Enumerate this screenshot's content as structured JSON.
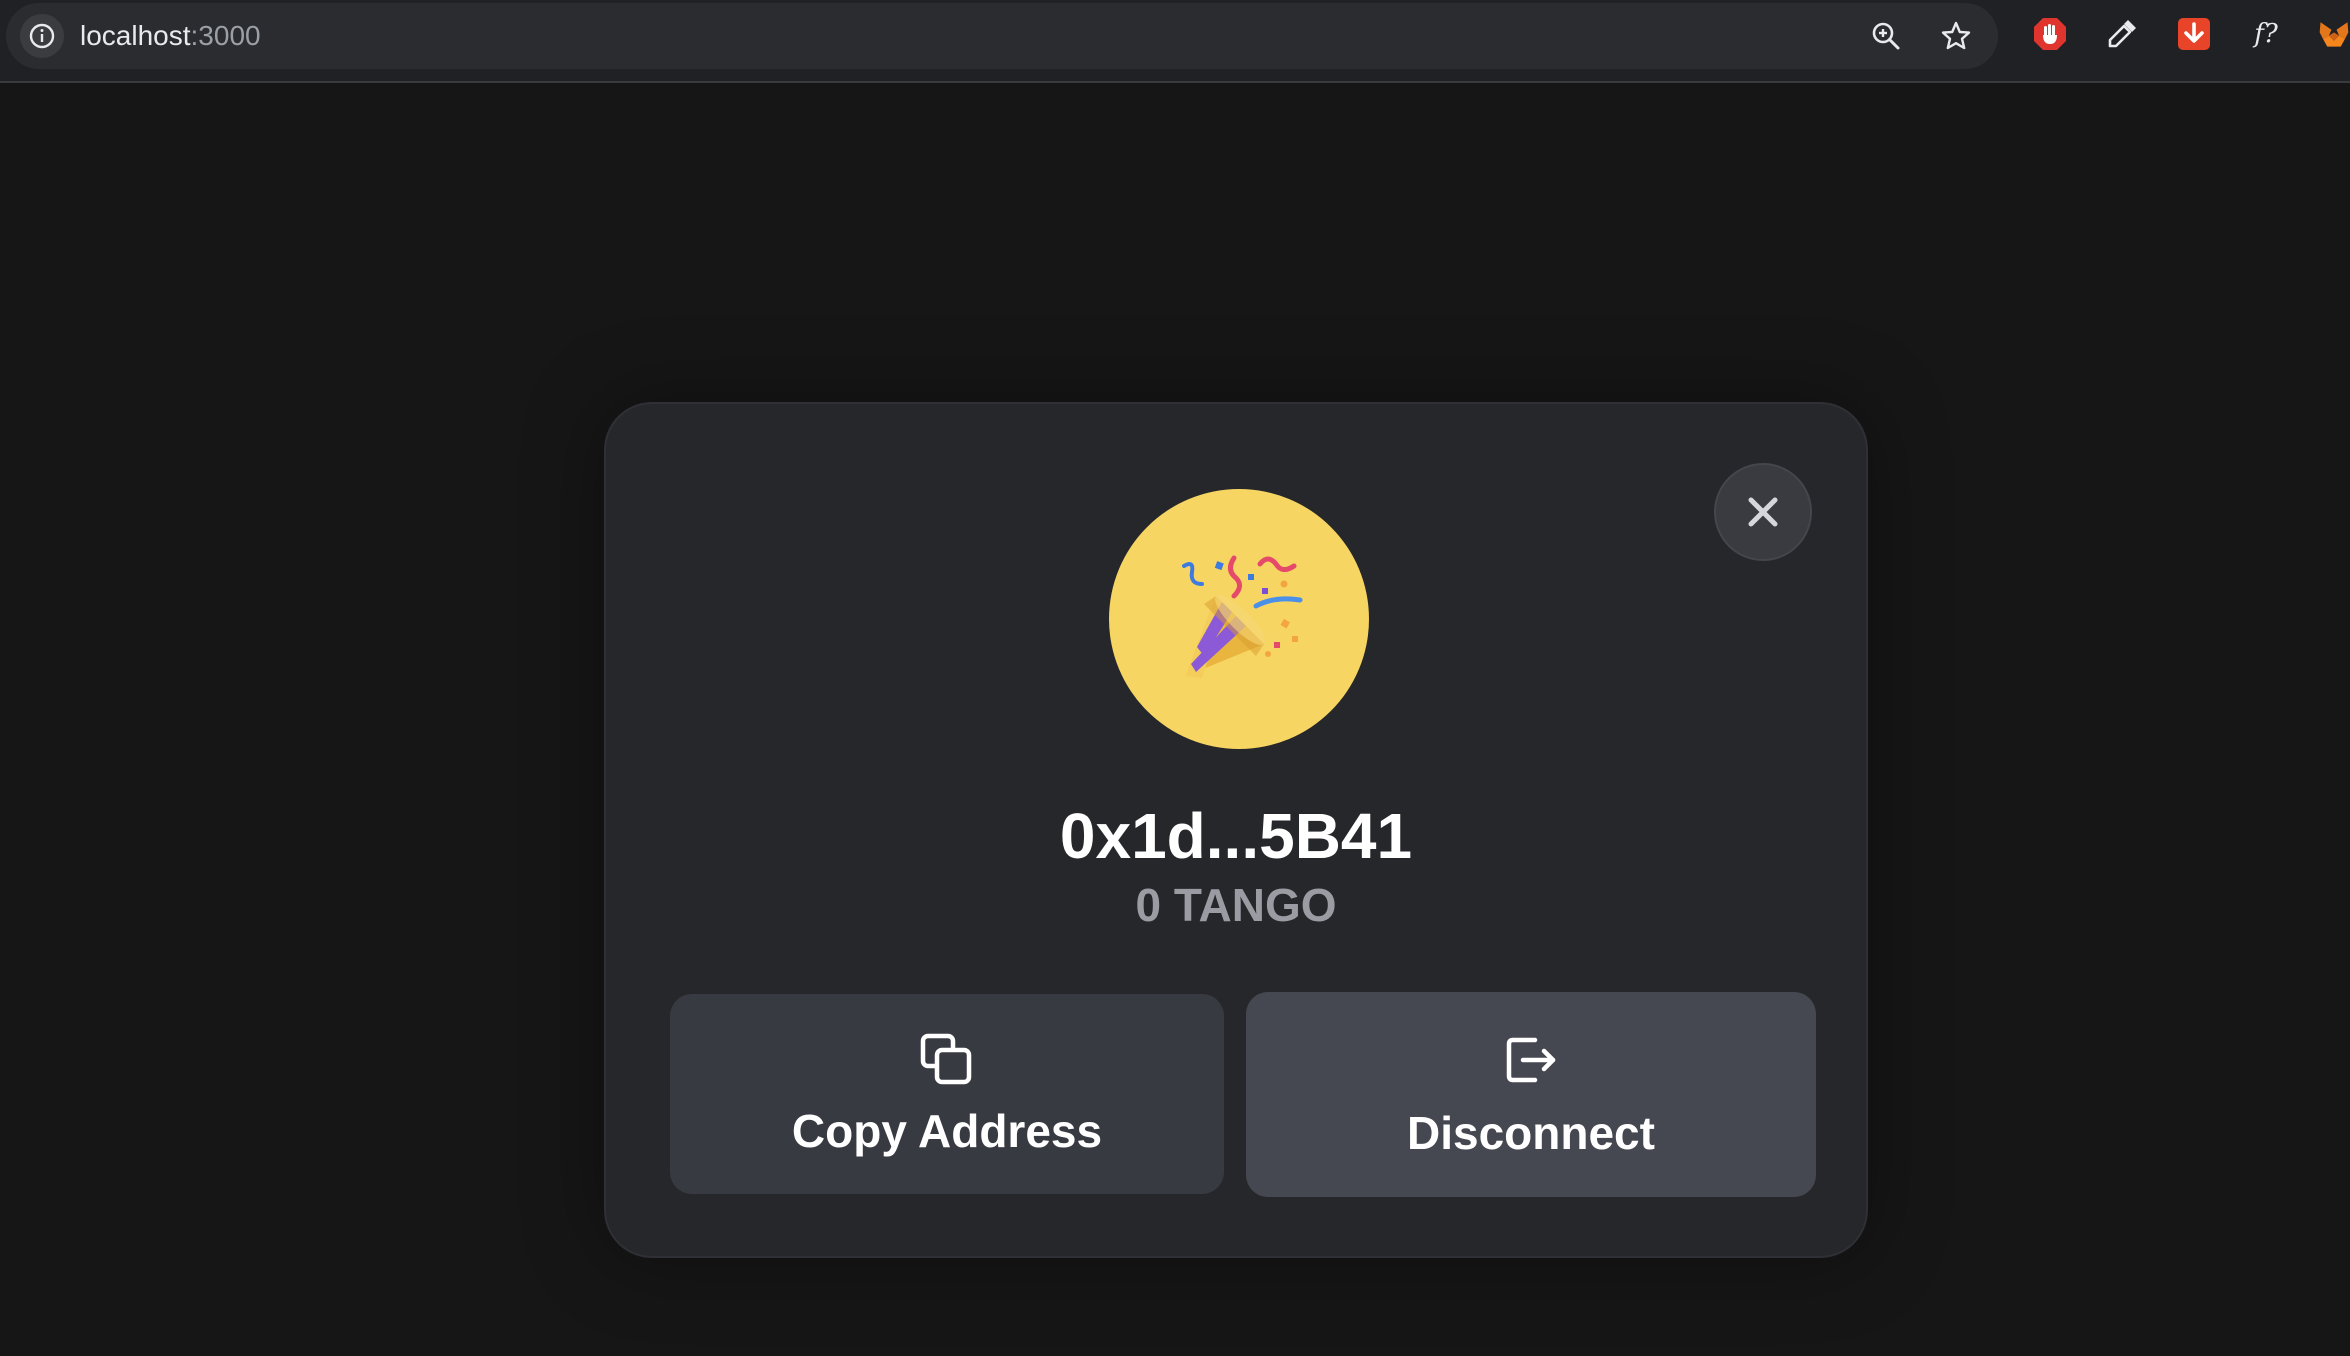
{
  "browser": {
    "url_host": "localhost",
    "url_port": ":3000",
    "icons": [
      "info-icon",
      "zoom-icon",
      "bookmark-star-icon"
    ],
    "extensions": [
      "adblock-extension-icon",
      "color-picker-extension-icon",
      "download-extension-icon",
      "font-finder-extension-icon",
      "metamask-extension-icon"
    ],
    "extension_labels": {
      "font_finder": "f?"
    }
  },
  "modal": {
    "avatar_emoji": "🎉",
    "avatar_bg": "#f6d563",
    "address": "0x1d...5B41",
    "balance": "0 TANGO",
    "copy_label": "Copy Address",
    "copy_icon": "copy-icon",
    "disconnect_label": "Disconnect",
    "disconnect_icon": "logout-icon",
    "close_icon": "close-icon"
  },
  "colors": {
    "page_bg": "#161617",
    "modal_bg": "#26272b",
    "secondary_text": "#9b9ca3"
  }
}
